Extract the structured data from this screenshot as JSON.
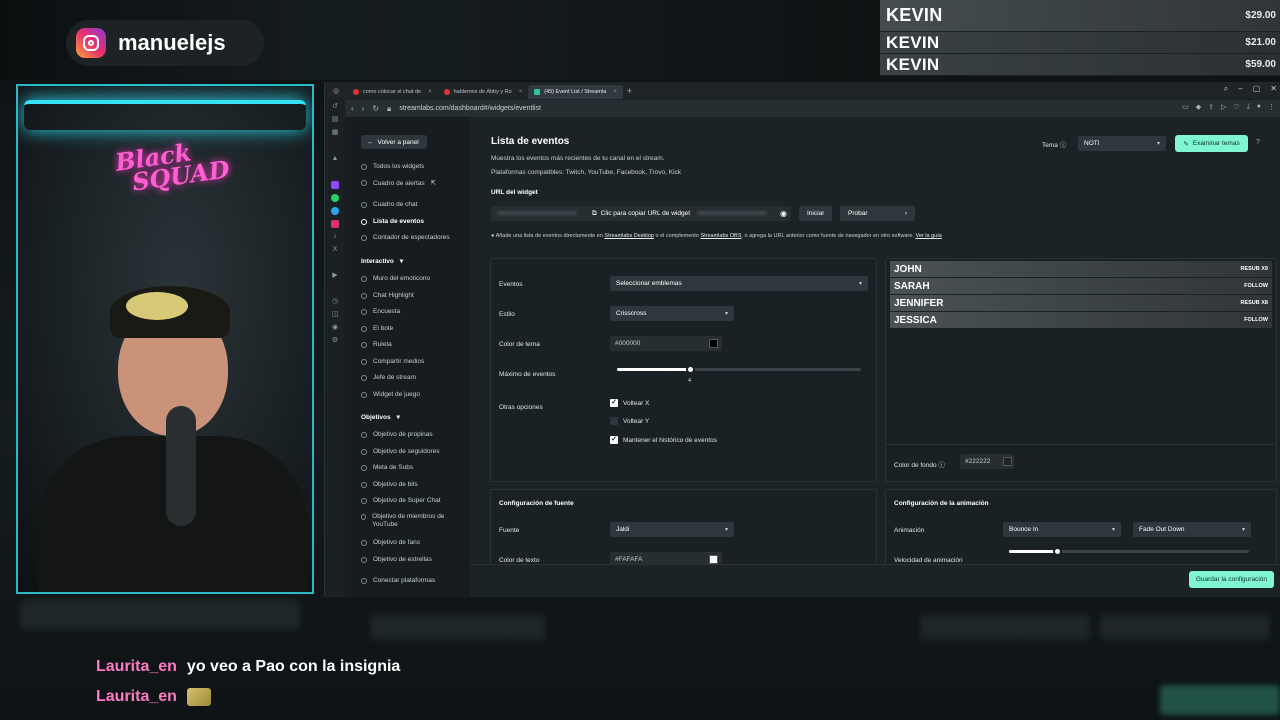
{
  "instagram": {
    "handle": "manuelejs",
    "icon": "instagram-icon"
  },
  "donations": [
    {
      "name": "KEVIN",
      "amount": "$29.00"
    },
    {
      "name": "KEVIN",
      "amount": "$21.00"
    },
    {
      "name": "KEVIN",
      "amount": "$59.00"
    }
  ],
  "webcam": {
    "neon_logo_line1": "Black",
    "neon_logo_line2": "SQUAD"
  },
  "browser": {
    "tabs": [
      {
        "label": "como colocar el chat de"
      },
      {
        "label": "hablemos de Abby y Ro"
      },
      {
        "label": "(45) Event List / Streamla"
      }
    ],
    "url": "streamlabs.com/dashboard#/widgets/eventlist"
  },
  "sidebar": {
    "back_label": "Volver a panel",
    "items": [
      "Todos los widgets",
      "Cuadro de alertas",
      "Cuadro de chat",
      "Lista de eventos",
      "Contador de espectadores"
    ],
    "interactive_header": "Interactivo",
    "interactive_items": [
      "Muro del emoticono",
      "Chat Highlight",
      "Encuesta",
      "El bote",
      "Ruleta",
      "Compartir medios",
      "Jefe de stream",
      "Widget de juego"
    ],
    "goals_header": "Objetivos",
    "goals_items": [
      "Objetivo de propinas",
      "Objetivo de seguidores",
      "Meta de Subs",
      "Objetivo de bits",
      "Objetivo de Super Chat",
      "Objetivo de miembros de YouTube",
      "Objetivo de fans",
      "Objetivo de estrellas",
      "Conectar plataformas"
    ]
  },
  "main": {
    "title": "Lista de eventos",
    "description": "Muestra los eventos más recientes de tu canal en el stream.",
    "platforms": "Plataformas compatibles: Twitch, YouTube, Facebook, Trovo, Kick",
    "theme_label": "Tema",
    "theme_value": "NOTI",
    "explore_label": "Examinar temas",
    "widget_url_label": "URL del widget",
    "copy_url_label": "Clic para copiar URL de widget",
    "start_label": "Iniciar",
    "test_label": "Probar",
    "note_prefix": "Añade una lista de eventos directamente en",
    "note_link1": "Streamlabs Desktop",
    "note_mid": "o el complemento",
    "note_link2": "Streamlabs OBS",
    "note_suffix": ", o agrega la URL anterior como fuente de navegador en otro software.",
    "note_link3": "Ver la guía",
    "events_label": "Eventos",
    "events_value": "Seleccionar emblemas",
    "style_label": "Estilo",
    "style_value": "Crisscross",
    "theme_color_label": "Color de tema",
    "theme_color_value": "#000000",
    "max_events_label": "Máximo de eventos",
    "max_events_value": "4",
    "max_events_fraction": 0.3,
    "other_options_label": "Otras opciones",
    "options": [
      {
        "label": "Voltear X",
        "checked": true
      },
      {
        "label": "Voltear Y",
        "checked": false
      },
      {
        "label": "Mantener el histórico de eventos",
        "checked": true
      }
    ],
    "preview_events": [
      {
        "name": "JOHN",
        "type": "RESUB X9"
      },
      {
        "name": "SARAH",
        "type": "FOLLOW"
      },
      {
        "name": "JENNIFER",
        "type": "RESUB X8"
      },
      {
        "name": "JESSICA",
        "type": "FOLLOW"
      }
    ],
    "bg_color_label": "Color de fondo",
    "bg_color_value": "#222222",
    "font_config_label": "Configuración de fuente",
    "font_label": "Fuente",
    "font_value": "Jaldi",
    "text_color_label": "Color de texto",
    "text_color_value": "#FAFAFA",
    "anim_config_label": "Configuración de la animación",
    "anim_label": "Animación",
    "anim_in": "Bounce In",
    "anim_out": "Fade Out Down",
    "anim_speed_label": "Velocidad de animación",
    "anim_speed_fraction": 0.2,
    "save_label": "Guardar la configuración"
  },
  "chat": [
    {
      "user": "Laurita_en",
      "message": "yo veo a Pao con la insignia"
    },
    {
      "user": "Laurita_en",
      "message": ""
    }
  ],
  "colors": {
    "accent": "#80f5d2",
    "chat_user": "#ff7ac4",
    "neon": "#37e1f5"
  }
}
